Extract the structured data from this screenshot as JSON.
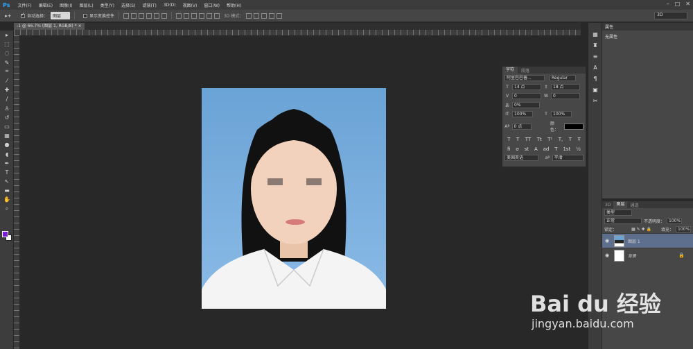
{
  "app": {
    "logo": "Ps"
  },
  "menu": [
    "文件(F)",
    "编辑(E)",
    "图像(I)",
    "图层(L)",
    "类型(Y)",
    "选择(S)",
    "滤镜(T)",
    "3D(D)",
    "视图(V)",
    "窗口(W)",
    "帮助(H)"
  ],
  "options": {
    "auto_select_label": "自动选择：",
    "auto_select_value": "图层",
    "show_transform_label": "显示变换控件",
    "mode_3d_label": "3D 模式：",
    "workspace": "3D"
  },
  "document_tab": {
    "label": "-1 @ 66.7% (图层 1, RGB/8) * ×"
  },
  "colors": {
    "foreground": "#7a1fd6",
    "background": "#ffffff",
    "accent": "#31a8ff"
  },
  "properties": {
    "tab": "属性",
    "content": "无属性"
  },
  "character": {
    "tabs": [
      "字符",
      "段落"
    ],
    "font_family": "阿里巴巴普...",
    "font_style": "Regular",
    "font_size": "14 点",
    "leading": "18 点",
    "kerning": "0",
    "tracking": "0",
    "scale_percent": "0%",
    "vertical_scale": "100%",
    "horizontal_scale": "100%",
    "baseline": "0 点",
    "color_label": "颜色：",
    "language": "美国英语",
    "antialias": "平滑",
    "styles": [
      "T",
      "T",
      "TT",
      "Tt",
      "T¹",
      "T,",
      "T",
      "Ŧ"
    ],
    "opentype": [
      "fi",
      "σ",
      "st",
      "A",
      "ad",
      "T",
      "1st",
      "½"
    ]
  },
  "layers": {
    "tabs": [
      "3D",
      "图层",
      "通道"
    ],
    "filter": "类型",
    "blend_mode": "正常",
    "opacity_label": "不透明度：",
    "opacity": "100%",
    "lock_label": "锁定：",
    "fill_label": "填充：",
    "fill": "100%",
    "items": [
      {
        "name": "图层 1"
      },
      {
        "name": "背景"
      }
    ]
  },
  "watermark": {
    "brand": "Bai du 经验",
    "url": "jingyan.baidu.com"
  }
}
